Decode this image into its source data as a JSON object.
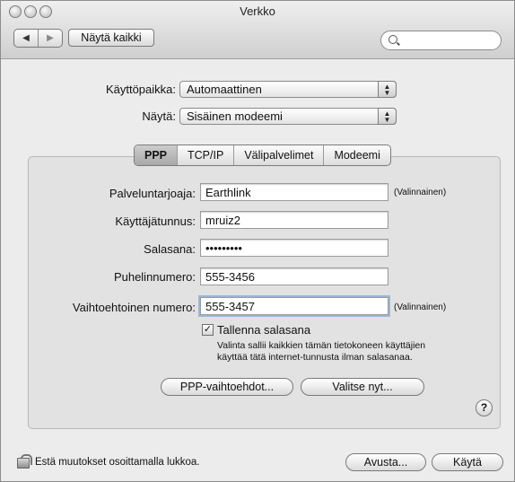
{
  "window": {
    "title": "Verkko"
  },
  "toolbar": {
    "show_all_label": "Näytä kaikki",
    "search_value": ""
  },
  "settings": {
    "location_label": "Käyttöpaikka:",
    "location_value": "Automaattinen",
    "show_label": "Näytä:",
    "show_value": "Sisäinen modeemi"
  },
  "tabs": [
    {
      "label": "PPP",
      "active": true
    },
    {
      "label": "TCP/IP",
      "active": false
    },
    {
      "label": "Välipalvelimet",
      "active": false
    },
    {
      "label": "Modeemi",
      "active": false
    }
  ],
  "form": {
    "provider_label": "Palveluntarjoaja:",
    "provider_value": "Earthlink",
    "provider_optional": "(Valinnainen)",
    "account_label": "Käyttäjätunnus:",
    "account_value": "mruiz2",
    "password_label": "Salasana:",
    "password_value": "•••••••••",
    "phone_label": "Puhelinnumero:",
    "phone_value": "555-3456",
    "alt_phone_label": "Vaihtoehtoinen numero:",
    "alt_phone_value": "555-3457",
    "alt_phone_optional": "(Valinnainen)",
    "save_password_label": "Tallenna salasana",
    "save_password_checked": true,
    "save_password_hint_1": "Valinta sallii kaikkien tämän tietokoneen käyttäjien",
    "save_password_hint_2": "käyttää tätä internet-tunnusta ilman salasanaa."
  },
  "buttons": {
    "ppp_options": "PPP-vaihtoehdot...",
    "dial_now": "Valitse nyt...",
    "help_symbol": "?",
    "assist": "Avusta...",
    "apply": "Käytä"
  },
  "footer": {
    "lock_text": "Estä muutokset osoittamalla lukkoa."
  }
}
